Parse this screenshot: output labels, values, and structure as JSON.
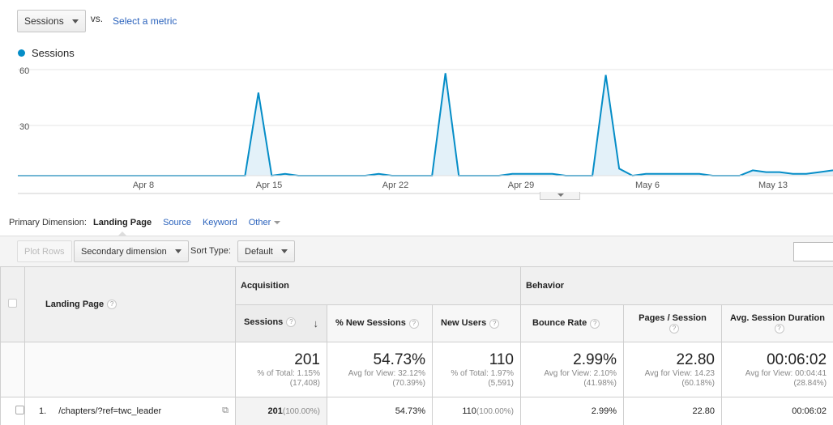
{
  "metric_selector": {
    "selected": "Sessions",
    "vs_label": "vs.",
    "compare_link": "Select a metric"
  },
  "chart_data": {
    "type": "area",
    "series": [
      {
        "name": "Sessions",
        "color": "#058dc7",
        "values": [
          0,
          0,
          0,
          0,
          0,
          0,
          0,
          0,
          0,
          0,
          0,
          0,
          0,
          0,
          0,
          0,
          0,
          0,
          47,
          0,
          1,
          0,
          0,
          0,
          0,
          0,
          0,
          1,
          0,
          0,
          0,
          0,
          58,
          0,
          0,
          0,
          0,
          1,
          1,
          1,
          1,
          0,
          0,
          0,
          57,
          4,
          0,
          1,
          1,
          1,
          1,
          1,
          0,
          0,
          0,
          3,
          2,
          2,
          1,
          1,
          2,
          3
        ]
      }
    ],
    "x_tick_labels": [
      "Apr 8",
      "Apr 15",
      "Apr 22",
      "Apr 29",
      "May 6",
      "May 13"
    ],
    "y_tick_labels": [
      "60",
      "30"
    ],
    "ylim": [
      0,
      60
    ]
  },
  "dimension_bar": {
    "label": "Primary Dimension:",
    "active": "Landing Page",
    "options": [
      "Source",
      "Keyword",
      "Other"
    ]
  },
  "toolbar": {
    "plot_rows": "Plot Rows",
    "secondary_dimension": "Secondary dimension",
    "sort_type_label": "Sort Type:",
    "sort_type_value": "Default"
  },
  "table": {
    "dimension_header": "Landing Page",
    "group_acquisition": "Acquisition",
    "group_behavior": "Behavior",
    "columns": [
      "Sessions",
      "% New Sessions",
      "New Users",
      "Bounce Rate",
      "Pages / Session",
      "Avg. Session Duration"
    ],
    "totals": [
      {
        "value": "201",
        "line1": "% of Total: 1.15%",
        "line2": "(17,408)"
      },
      {
        "value": "54.73%",
        "line1": "Avg for View: 32.12%",
        "line2": "(70.39%)"
      },
      {
        "value": "110",
        "line1": "% of Total: 1.97%",
        "line2": "(5,591)"
      },
      {
        "value": "2.99%",
        "line1": "Avg for View: 2.10%",
        "line2": "(41.98%)"
      },
      {
        "value": "22.80",
        "line1": "Avg for View: 14.23",
        "line2": "(60.18%)"
      },
      {
        "value": "00:06:02",
        "line1": "Avg for View: 00:04:41",
        "line2": "(28.84%)"
      }
    ],
    "row1": {
      "index": "1.",
      "page": "/chapters/?ref=twc_leader",
      "sessions": "201",
      "sessions_pct": "(100.00%)",
      "new_sessions": "54.73%",
      "new_users": "110",
      "new_users_pct": "(100.00%)",
      "bounce_rate": "2.99%",
      "pages_session": "22.80",
      "duration": "00:06:02"
    }
  }
}
